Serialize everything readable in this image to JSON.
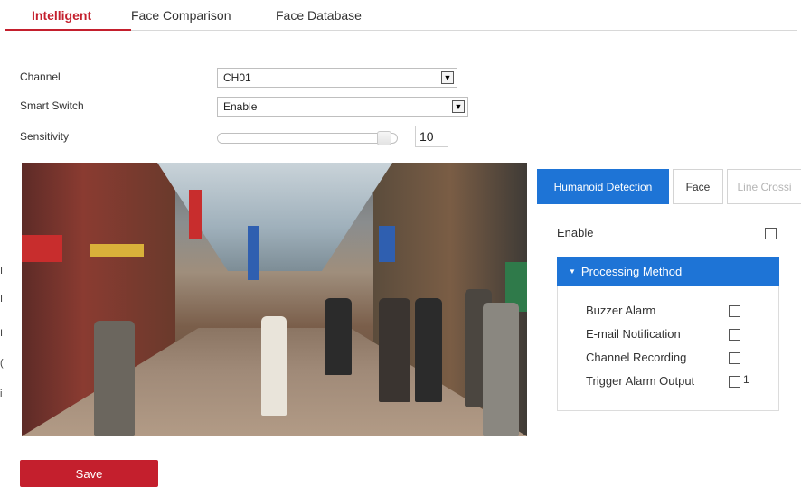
{
  "top_tabs": [
    {
      "label": "Intelligent",
      "active": true
    },
    {
      "label": "Face Comparison",
      "active": false
    },
    {
      "label": "Face Database",
      "active": false
    }
  ],
  "form": {
    "channel_label": "Channel",
    "channel_value": "CH01",
    "smart_switch_label": "Smart Switch",
    "smart_switch_value": "Enable",
    "sensitivity_label": "Sensitivity",
    "sensitivity_value": "10",
    "sensitivity_fraction": 1.0
  },
  "detection_tabs": [
    {
      "label": "Humanoid Detection",
      "active": true
    },
    {
      "label": "Face",
      "active": false
    },
    {
      "label": "Line Crossi",
      "active": false,
      "disabled": true
    }
  ],
  "enable": {
    "label": "Enable",
    "checked": false
  },
  "processing": {
    "header": "Processing Method",
    "items": [
      {
        "label": "Buzzer Alarm",
        "checked": false,
        "suffix": ""
      },
      {
        "label": "E-mail Notification",
        "checked": false,
        "suffix": ""
      },
      {
        "label": "Channel Recording",
        "checked": false,
        "suffix": ""
      },
      {
        "label": "Trigger Alarm Output",
        "checked": false,
        "suffix": "1"
      }
    ]
  },
  "left_edge_marks": [
    "I",
    "I",
    "I",
    "(",
    "i"
  ],
  "save_label": "Save",
  "colors": {
    "accent_red": "#c41f2d",
    "accent_blue": "#1e74d6"
  }
}
